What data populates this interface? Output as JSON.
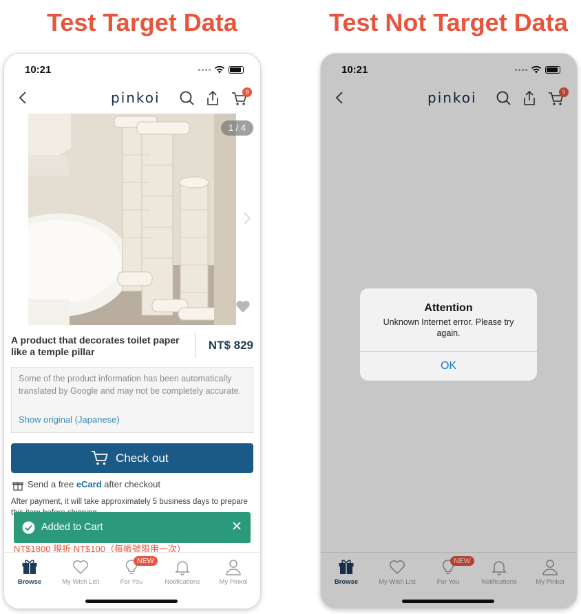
{
  "headings": {
    "left": "Test Target Data",
    "right": "Test Not Target Data"
  },
  "status_bar": {
    "time": "10:21"
  },
  "header": {
    "logo": "pinkoi",
    "cart_count": "9",
    "icons": [
      "back-chevron-icon",
      "search-icon",
      "share-icon",
      "cart-icon"
    ]
  },
  "product": {
    "image_counter": "1 / 4",
    "title": "A product that decorates toilet paper like a temple pillar",
    "price": "NT$ 829"
  },
  "translation_notice": {
    "message": "Some of the product information has been automatically translated by Google and may not be completely accurate.",
    "link": "Show original (Japanese)"
  },
  "checkout_button": "Check out",
  "ecard": {
    "prefix": "Send a free ",
    "link": "eCard",
    "suffix": " after checkout"
  },
  "shipping_note": "After payment, it will take approximately 5 business days to prepare this item before shipping.",
  "toast": {
    "label": "Added to Cart"
  },
  "promo": "NT$1800 現折 NT$100（每帳號限用一次）",
  "tabs": [
    {
      "label": "Browse",
      "icon": "gift-icon"
    },
    {
      "label": "My Wish List",
      "icon": "heart-icon"
    },
    {
      "label": "For You",
      "icon": "lightbulb-icon",
      "badge": "NEW"
    },
    {
      "label": "Notifications",
      "icon": "bell-icon"
    },
    {
      "label": "My Pinkoi",
      "icon": "person-icon"
    }
  ],
  "dialog": {
    "title": "Attention",
    "message": "Unknown Internet error. Please try again.",
    "button": "OK"
  },
  "colors": {
    "heading": "#e8553d",
    "brand_navy": "#1b5a86",
    "toast_green": "#2a9a7a",
    "badge_red": "#e8553d",
    "link_blue": "#3a8bb5",
    "dialog_button": "#1677d9"
  }
}
